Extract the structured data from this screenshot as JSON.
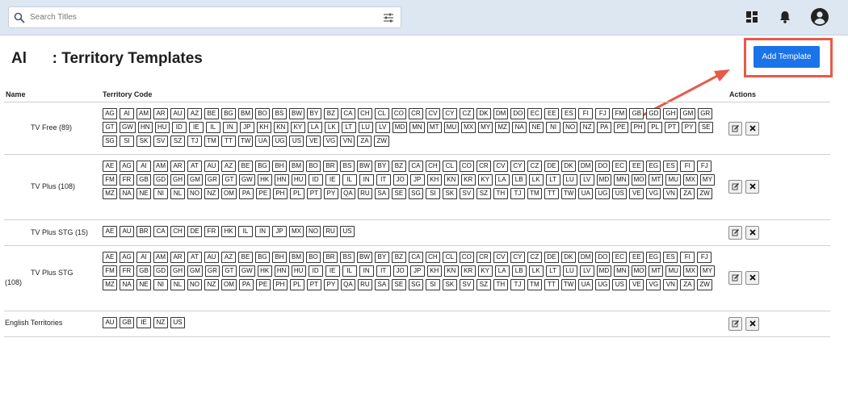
{
  "search": {
    "placeholder": "Search Titles",
    "value": ""
  },
  "page": {
    "title": "Al      : Territory Templates",
    "add_button_label": "Add Template"
  },
  "table": {
    "columns": {
      "name": "Name",
      "codes": "Territory Code",
      "actions": "Actions"
    },
    "rows": [
      {
        "name": "TV Free (89)",
        "codes": [
          "AG",
          "AI",
          "AM",
          "AR",
          "AU",
          "AZ",
          "BE",
          "BG",
          "BM",
          "BO",
          "BS",
          "BW",
          "BY",
          "BZ",
          "CA",
          "CH",
          "CL",
          "CO",
          "CR",
          "CV",
          "CY",
          "CZ",
          "DK",
          "DM",
          "DO",
          "EC",
          "EE",
          "ES",
          "FI",
          "FJ",
          "FM",
          "GB",
          "GD",
          "GH",
          "GM",
          "GR",
          "GT",
          "GW",
          "HN",
          "HU",
          "ID",
          "IE",
          "IL",
          "IN",
          "JP",
          "KH",
          "KN",
          "KY",
          "LA",
          "LK",
          "LT",
          "LU",
          "LV",
          "MD",
          "MN",
          "MT",
          "MU",
          "MX",
          "MY",
          "MZ",
          "NA",
          "NE",
          "NI",
          "NO",
          "NZ",
          "PA",
          "PE",
          "PH",
          "PL",
          "PT",
          "PY",
          "SE",
          "SG",
          "SI",
          "SK",
          "SV",
          "SZ",
          "TJ",
          "TM",
          "TT",
          "TW",
          "UA",
          "UG",
          "US",
          "VE",
          "VG",
          "VN",
          "ZA",
          "ZW"
        ]
      },
      {
        "name": "TV Plus (108)",
        "codes": [
          "AE",
          "AG",
          "AI",
          "AM",
          "AR",
          "AT",
          "AU",
          "AZ",
          "BE",
          "BG",
          "BH",
          "BM",
          "BO",
          "BR",
          "BS",
          "BW",
          "BY",
          "BZ",
          "CA",
          "CH",
          "CL",
          "CO",
          "CR",
          "CV",
          "CY",
          "CZ",
          "DE",
          "DK",
          "DM",
          "DO",
          "EC",
          "EE",
          "EG",
          "ES",
          "FI",
          "FJ",
          "FM",
          "FR",
          "GB",
          "GD",
          "GH",
          "GM",
          "GR",
          "GT",
          "GW",
          "HK",
          "HN",
          "HU",
          "ID",
          "IE",
          "IL",
          "IN",
          "IT",
          "JO",
          "JP",
          "KH",
          "KN",
          "KR",
          "KY",
          "LA",
          "LB",
          "LK",
          "LT",
          "LU",
          "LV",
          "MD",
          "MN",
          "MO",
          "MT",
          "MU",
          "MX",
          "MY",
          "MZ",
          "NA",
          "NE",
          "NI",
          "NL",
          "NO",
          "NZ",
          "OM",
          "PA",
          "PE",
          "PH",
          "PL",
          "PT",
          "PY",
          "QA",
          "RU",
          "SA",
          "SE",
          "SG",
          "SI",
          "SK",
          "SV",
          "SZ",
          "TH",
          "TJ",
          "TM",
          "TT",
          "TW",
          "UA",
          "UG",
          "US",
          "VE",
          "VG",
          "VN",
          "ZA",
          "ZW"
        ]
      },
      {
        "name": "TV Plus STG (15)",
        "codes": [
          "AE",
          "AU",
          "BR",
          "CA",
          "CH",
          "DE",
          "FR",
          "HK",
          "IL",
          "IN",
          "JP",
          "MX",
          "NO",
          "RU",
          "US"
        ]
      },
      {
        "name_line1": "TV Plus STG",
        "name_line2": "(108)",
        "codes": [
          "AE",
          "AG",
          "AI",
          "AM",
          "AR",
          "AT",
          "AU",
          "AZ",
          "BE",
          "BG",
          "BH",
          "BM",
          "BO",
          "BR",
          "BS",
          "BW",
          "BY",
          "BZ",
          "CA",
          "CH",
          "CL",
          "CO",
          "CR",
          "CV",
          "CY",
          "CZ",
          "DE",
          "DK",
          "DM",
          "DO",
          "EC",
          "EE",
          "EG",
          "ES",
          "FI",
          "FJ",
          "FM",
          "FR",
          "GB",
          "GD",
          "GH",
          "GM",
          "GR",
          "GT",
          "GW",
          "HK",
          "HN",
          "HU",
          "ID",
          "IE",
          "IL",
          "IN",
          "IT",
          "JO",
          "JP",
          "KH",
          "KN",
          "KR",
          "KY",
          "LA",
          "LB",
          "LK",
          "LT",
          "LU",
          "LV",
          "MD",
          "MN",
          "MO",
          "MT",
          "MU",
          "MX",
          "MY",
          "MZ",
          "NA",
          "NE",
          "NI",
          "NL",
          "NO",
          "NZ",
          "OM",
          "PA",
          "PE",
          "PH",
          "PL",
          "PT",
          "PY",
          "QA",
          "RU",
          "SA",
          "SE",
          "SG",
          "SI",
          "SK",
          "SV",
          "SZ",
          "TH",
          "TJ",
          "TM",
          "TT",
          "TW",
          "UA",
          "UG",
          "US",
          "VE",
          "VG",
          "VN",
          "ZA",
          "ZW"
        ]
      },
      {
        "name": "English Territories",
        "codes": [
          "AU",
          "GB",
          "IE",
          "NZ",
          "US"
        ]
      }
    ]
  },
  "icons": {
    "search": "search-icon",
    "filter": "filter-sliders-icon",
    "dashboard": "dashboard-icon",
    "notifications": "bell-icon",
    "account": "account-circle-icon",
    "edit": "edit-icon",
    "delete": "delete-x-icon"
  },
  "colors": {
    "topbar": "#dde7f2",
    "primary": "#1a73e8",
    "highlight": "#e8594a"
  }
}
